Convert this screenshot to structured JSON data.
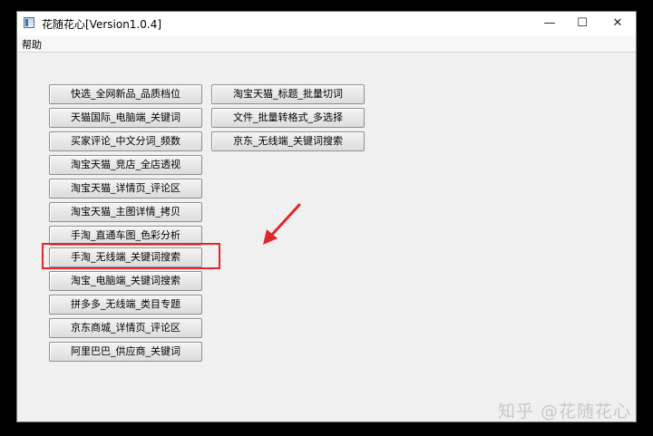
{
  "window": {
    "title": "花随花心[Version1.0.4]",
    "controls": {
      "minimize": "—",
      "maximize": "☐",
      "close": "✕"
    }
  },
  "menu": {
    "help": "帮助"
  },
  "left_buttons": [
    "快选_全网新品_品质档位",
    "天猫国际_电脑端_关键词",
    "买家评论_中文分词_频数",
    "淘宝天猫_竞店_全店透视",
    "淘宝天猫_详情页_评论区",
    "淘宝天猫_主图详情_拷贝",
    "手淘_直通车图_色彩分析",
    "手淘_无线端_关键词搜索",
    "淘宝_电脑端_关键词搜索",
    "拼多多_无线端_类目专题",
    "京东商城_详情页_评论区",
    "阿里巴巴_供应商_关键词"
  ],
  "right_buttons": [
    "淘宝天猫_标题_批量切词",
    "文件_批量转格式_多选择",
    "京东_无线端_关键词搜索"
  ],
  "annotation": {
    "highlight_color": "#e0272b",
    "highlighted_button": "手淘_无线端_关键词搜索"
  },
  "watermark": "知乎 @花随花心"
}
